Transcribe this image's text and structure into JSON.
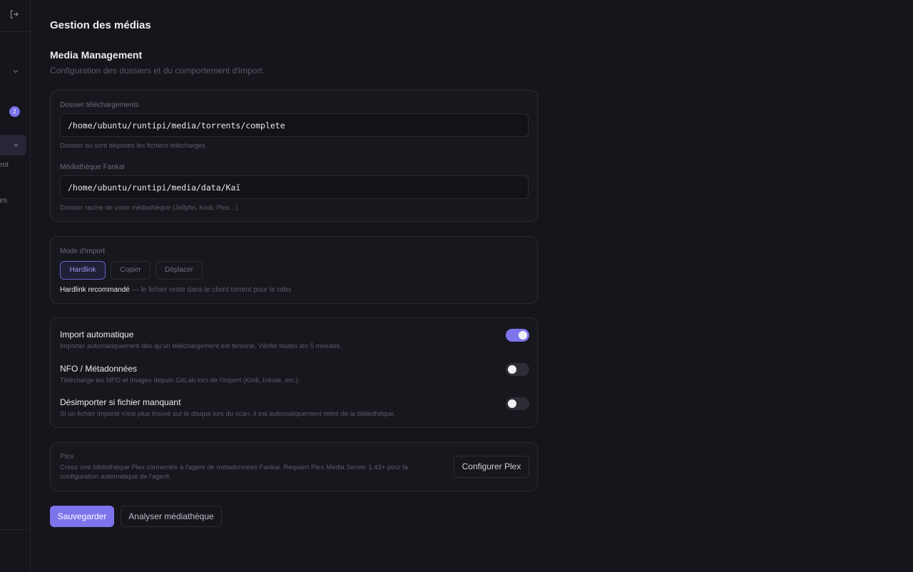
{
  "sidebar": {
    "badge_count": "2",
    "partial_item_1": "ement",
    "partial_item_2": "ries"
  },
  "page": {
    "title": "Gestion des médias",
    "section_title": "Media Management",
    "section_subtitle": "Configuration des dossiers et du comportement d'import."
  },
  "folders": {
    "downloads_label": "Dossier téléchargements",
    "downloads_value": "/home/ubuntu/runtipi/media/torrents/complete",
    "downloads_hint": "Dossier où sont déposés les fichiers téléchargés",
    "library_label": "Médiathèque Fankai",
    "library_value": "/home/ubuntu/runtipi/media/data/Kaï",
    "library_hint": "Dossier racine de votre médiathèque (Jellyfin, Kodi, Plex...)"
  },
  "import_mode": {
    "label": "Mode d'import",
    "options": [
      "Hardlink",
      "Copier",
      "Déplacer"
    ],
    "selected": "Hardlink",
    "note_strong": "Hardlink recommandé",
    "note_rest": " — le fichier reste dans le client torrent pour le ratio"
  },
  "toggles": [
    {
      "title": "Import automatique",
      "description": "Importer automatiquement dès qu'un téléchargement est terminé. Vérifie toutes les 5 minutes.",
      "enabled": true
    },
    {
      "title": "NFO / Métadonnées",
      "description": "Télécharge les NFO et images depuis GitLab lors de l'import (Kodi, Infuse, etc.).",
      "enabled": false
    },
    {
      "title": "Désimporter si fichier manquant",
      "description": "Si un fichier importé n'est plus trouvé sur le disque lors du scan, il est automatiquement retiré de la bibliothèque.",
      "enabled": false
    }
  ],
  "plex": {
    "label": "Plex",
    "description": "Créez une bibliothèque Plex connectée à l'agent de métadonnées Fankai. Requiert Plex Media Server 1.43+ pour la configuration automatique de l'agent.",
    "button": "Configurer Plex"
  },
  "actions": {
    "save": "Sauvegarder",
    "analyze": "Analyser médiathèque"
  },
  "colors": {
    "accent": "#7d74ec",
    "background": "#15151b",
    "card": "#17171e"
  }
}
